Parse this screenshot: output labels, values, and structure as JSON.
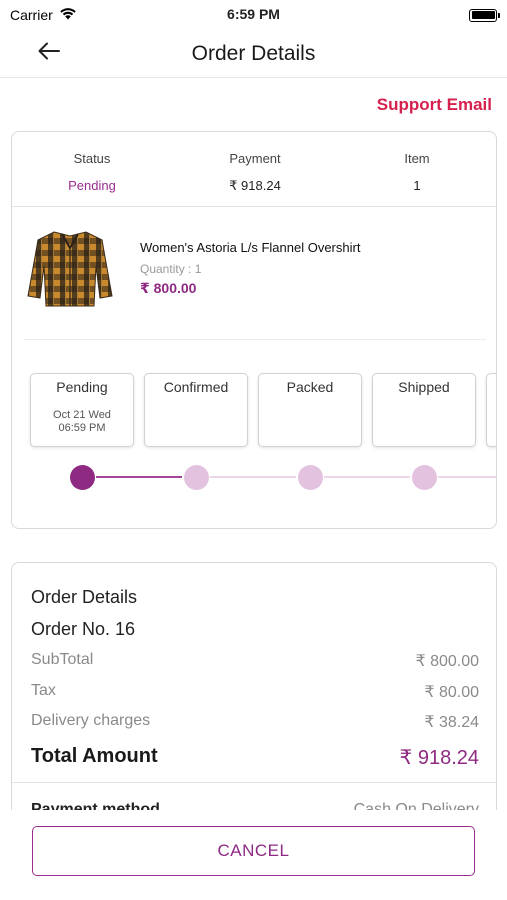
{
  "status_bar": {
    "carrier": "Carrier",
    "time": "6:59 PM"
  },
  "nav": {
    "title": "Order Details",
    "back_icon": "arrow-left-icon"
  },
  "support_email_label": "Support Email",
  "summary": {
    "status_label": "Status",
    "status_value": "Pending",
    "payment_label": "Payment",
    "payment_value": "₹ 918.24",
    "item_label": "Item",
    "item_value": "1"
  },
  "product": {
    "name": "Women's Astoria L/s Flannel Overshirt",
    "quantity": "Quantity :  1",
    "price": "₹ 800.00"
  },
  "tracking": {
    "steps": [
      {
        "label": "Pending",
        "date": "Oct 21 Wed",
        "time": "06:59 PM",
        "active": true
      },
      {
        "label": "Confirmed",
        "date": "",
        "time": "",
        "active": false
      },
      {
        "label": "Packed",
        "date": "",
        "time": "",
        "active": false
      },
      {
        "label": "Shipped",
        "date": "",
        "time": "",
        "active": false
      }
    ]
  },
  "order_details": {
    "heading": "Order Details",
    "order_no": "Order No. 16",
    "subtotal_label": "SubTotal",
    "subtotal_value": "₹ 800.00",
    "tax_label": "Tax",
    "tax_value": "₹ 80.00",
    "delivery_label": "Delivery charges",
    "delivery_value": "₹ 38.24",
    "total_label": "Total Amount",
    "total_value": "₹ 918.24",
    "payment_method_label": "Payment method",
    "payment_method_value": "Cash On Delivery"
  },
  "cancel_label": "CANCEL",
  "colors": {
    "accent": "#9b2c8e",
    "support": "#d6214e",
    "inactive_dot": "#e3c2df"
  }
}
